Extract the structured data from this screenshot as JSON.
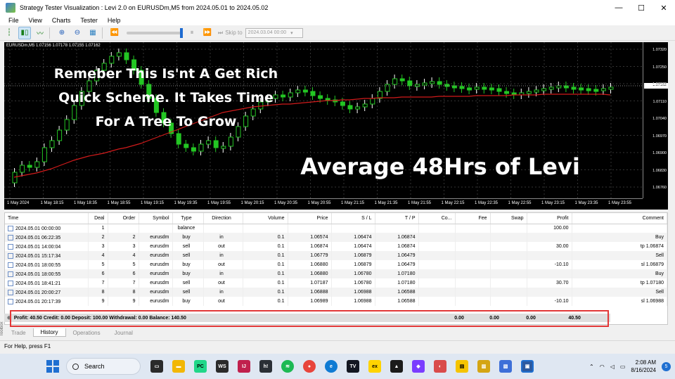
{
  "window": {
    "title": "Strategy Tester Visualization : Levi 2.0 on EURUSDm,M5 from 2024.05.01 to 2024.05.02",
    "minimize": "—",
    "maximize": "☐",
    "close": "✕"
  },
  "menu": [
    "File",
    "View",
    "Charts",
    "Tester",
    "Help"
  ],
  "toolbar": {
    "skip_to_label": "Skip to",
    "skip_date": "2024.03.04 00:00",
    "speed_level": 1.0
  },
  "chart": {
    "header": "EURUSDm,M5  1.07156  1.07178  1.07155  1.07162",
    "overlay_line1": "Remeber This Is'nt A Get Rich",
    "overlay_line2": "Quick Scheme. It Takes Time",
    "overlay_line3": "For A Tree To Grow",
    "overlay_big": "Average 48Hrs of Levi",
    "price_labels": [
      "1.07320",
      "1.07250",
      "1.07180",
      "1.07110",
      "1.07040",
      "1.06970",
      "1.06900",
      "1.06830",
      "1.06760"
    ],
    "current_price": "1.07162",
    "time_labels": [
      "1 May 2024",
      "1 May 18:15",
      "1 May 18:35",
      "1 May 18:55",
      "1 May 19:15",
      "1 May 19:35",
      "1 May 19:55",
      "1 May 20:15",
      "1 May 20:35",
      "1 May 20:55",
      "1 May 21:15",
      "1 May 21:35",
      "1 May 21:55",
      "1 May 22:15",
      "1 May 22:35",
      "1 May 22:55",
      "1 May 23:15",
      "1 May 23:35",
      "1 May 23:55"
    ]
  },
  "table": {
    "headers": [
      "Time",
      "Deal",
      "Order",
      "Symbol",
      "Type",
      "Direction",
      "Volume",
      "Price",
      "S / L",
      "T / P",
      "Co...",
      "Fee",
      "Swap",
      "Profit",
      "Comment"
    ],
    "rows": [
      [
        "2024.05.01 00:00:00",
        "1",
        "",
        "",
        "balance",
        "",
        "",
        "",
        "",
        "",
        "",
        "",
        "",
        "100.00",
        ""
      ],
      [
        "2024.05.01 06:22:35",
        "2",
        "2",
        "eurusdm",
        "buy",
        "in",
        "0.1",
        "1.06574",
        "1.06474",
        "1.06874",
        "",
        "",
        "",
        "",
        "Buy"
      ],
      [
        "2024.05.01 14:00:04",
        "3",
        "3",
        "eurusdm",
        "sell",
        "out",
        "0.1",
        "1.06874",
        "1.06474",
        "1.06874",
        "",
        "",
        "",
        "30.00",
        "tp 1.06874"
      ],
      [
        "2024.05.01 15:17:34",
        "4",
        "4",
        "eurusdm",
        "sell",
        "in",
        "0.1",
        "1.06779",
        "1.06879",
        "1.06479",
        "",
        "",
        "",
        "",
        "Sell"
      ],
      [
        "2024.05.01 18:00:55",
        "5",
        "5",
        "eurusdm",
        "buy",
        "out",
        "0.1",
        "1.06880",
        "1.06879",
        "1.06479",
        "",
        "",
        "",
        "-10.10",
        "sl 1.06879"
      ],
      [
        "2024.05.01 18:00:55",
        "6",
        "6",
        "eurusdm",
        "buy",
        "in",
        "0.1",
        "1.06880",
        "1.06780",
        "1.07180",
        "",
        "",
        "",
        "",
        "Buy"
      ],
      [
        "2024.05.01 18:41:21",
        "7",
        "7",
        "eurusdm",
        "sell",
        "out",
        "0.1",
        "1.07187",
        "1.06780",
        "1.07180",
        "",
        "",
        "",
        "30.70",
        "tp 1.07180"
      ],
      [
        "2024.05.01 20:00:27",
        "8",
        "8",
        "eurusdm",
        "sell",
        "in",
        "0.1",
        "1.06888",
        "1.06988",
        "1.06588",
        "",
        "",
        "",
        "",
        "Sell"
      ],
      [
        "2024.05.01 20:17:39",
        "9",
        "9",
        "eurusdm",
        "buy",
        "out",
        "0.1",
        "1.06989",
        "1.06988",
        "1.06588",
        "",
        "",
        "",
        "-10.10",
        "sl 1.06988"
      ]
    ]
  },
  "summary": {
    "text": "Profit: 40.50  Credit: 0.00  Deposit: 100.00  Withdrawal: 0.00  Balance: 140.50",
    "fee": "0.00",
    "swap": "0.00",
    "commission": "0.00",
    "profit": "40.50"
  },
  "tabs": [
    "Trade",
    "History",
    "Operations",
    "Journal"
  ],
  "toolbox_label": "Toolbox",
  "status": "For Help, press F1",
  "taskbar": {
    "search": "Search",
    "time": "2:08 AM",
    "date": "8/16/2024",
    "notifications": "5"
  }
}
